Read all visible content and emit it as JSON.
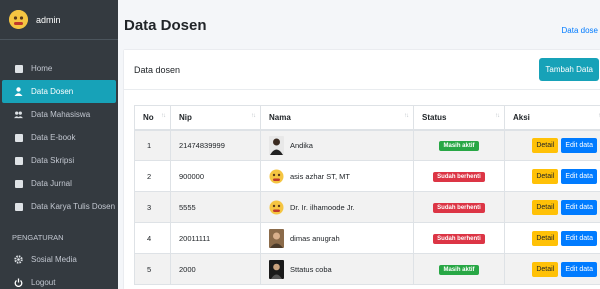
{
  "sidebar": {
    "user_name": "admin",
    "items": [
      {
        "label": "Home",
        "icon": "tachometer-icon"
      },
      {
        "label": "Data Dosen",
        "icon": "user-icon"
      },
      {
        "label": "Data Mahasiswa",
        "icon": "users-icon"
      },
      {
        "label": "Data E-book",
        "icon": "book-icon"
      },
      {
        "label": "Data Skripsi",
        "icon": "book-icon"
      },
      {
        "label": "Data Jurnal",
        "icon": "book-icon"
      },
      {
        "label": "Data Karya Tulis Dosen",
        "icon": "book-icon"
      }
    ],
    "section_header": "PENGATURAN",
    "settings": [
      {
        "label": "Sosial Media",
        "icon": "gear-icon"
      },
      {
        "label": "Logout",
        "icon": "power-icon"
      }
    ]
  },
  "header": {
    "title": "Data Dosen",
    "breadcrumb": "Data dose"
  },
  "card": {
    "title": "Data dosen",
    "add_button": "Tambah Data"
  },
  "table": {
    "columns": [
      "No",
      "Nip",
      "Nama",
      "Status",
      "Aksi"
    ],
    "rows": [
      {
        "no": "1",
        "nip": "21474839999",
        "nama": "Andika",
        "status": "Masih aktif",
        "status_type": "aktif"
      },
      {
        "no": "2",
        "nip": "900000",
        "nama": "asis azhar ST, MT",
        "status": "Sudah berhenti",
        "status_type": "berhenti"
      },
      {
        "no": "3",
        "nip": "5555",
        "nama": "Dr. Ir. ilhamoode Jr.",
        "status": "Sudah berhenti",
        "status_type": "berhenti"
      },
      {
        "no": "4",
        "nip": "20011111",
        "nama": "dimas anugrah",
        "status": "Sudah berhenti",
        "status_type": "berhenti"
      },
      {
        "no": "5",
        "nip": "2000",
        "nama": "Sttatus coba",
        "status": "Masih aktif",
        "status_type": "aktif"
      }
    ],
    "detail_label": "Detail",
    "edit_label": "Edit data"
  },
  "colors": {
    "sidebar_bg": "#343a40",
    "active": "#17a2b8",
    "success": "#28a745",
    "danger": "#dc3545",
    "warning": "#ffc107",
    "primary": "#007bff"
  }
}
